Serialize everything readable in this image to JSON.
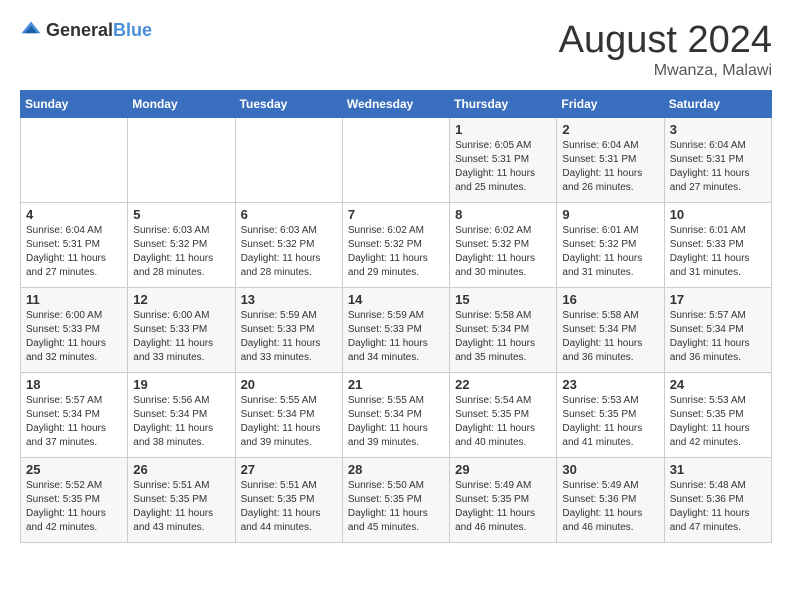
{
  "logo": {
    "general": "General",
    "blue": "Blue"
  },
  "title": "August 2024",
  "location": "Mwanza, Malawi",
  "days_of_week": [
    "Sunday",
    "Monday",
    "Tuesday",
    "Wednesday",
    "Thursday",
    "Friday",
    "Saturday"
  ],
  "weeks": [
    [
      {
        "day": "",
        "sunrise": "",
        "sunset": "",
        "daylight": ""
      },
      {
        "day": "",
        "sunrise": "",
        "sunset": "",
        "daylight": ""
      },
      {
        "day": "",
        "sunrise": "",
        "sunset": "",
        "daylight": ""
      },
      {
        "day": "",
        "sunrise": "",
        "sunset": "",
        "daylight": ""
      },
      {
        "day": "1",
        "sunrise": "Sunrise: 6:05 AM",
        "sunset": "Sunset: 5:31 PM",
        "daylight": "Daylight: 11 hours and 25 minutes."
      },
      {
        "day": "2",
        "sunrise": "Sunrise: 6:04 AM",
        "sunset": "Sunset: 5:31 PM",
        "daylight": "Daylight: 11 hours and 26 minutes."
      },
      {
        "day": "3",
        "sunrise": "Sunrise: 6:04 AM",
        "sunset": "Sunset: 5:31 PM",
        "daylight": "Daylight: 11 hours and 27 minutes."
      }
    ],
    [
      {
        "day": "4",
        "sunrise": "Sunrise: 6:04 AM",
        "sunset": "Sunset: 5:31 PM",
        "daylight": "Daylight: 11 hours and 27 minutes."
      },
      {
        "day": "5",
        "sunrise": "Sunrise: 6:03 AM",
        "sunset": "Sunset: 5:32 PM",
        "daylight": "Daylight: 11 hours and 28 minutes."
      },
      {
        "day": "6",
        "sunrise": "Sunrise: 6:03 AM",
        "sunset": "Sunset: 5:32 PM",
        "daylight": "Daylight: 11 hours and 28 minutes."
      },
      {
        "day": "7",
        "sunrise": "Sunrise: 6:02 AM",
        "sunset": "Sunset: 5:32 PM",
        "daylight": "Daylight: 11 hours and 29 minutes."
      },
      {
        "day": "8",
        "sunrise": "Sunrise: 6:02 AM",
        "sunset": "Sunset: 5:32 PM",
        "daylight": "Daylight: 11 hours and 30 minutes."
      },
      {
        "day": "9",
        "sunrise": "Sunrise: 6:01 AM",
        "sunset": "Sunset: 5:32 PM",
        "daylight": "Daylight: 11 hours and 31 minutes."
      },
      {
        "day": "10",
        "sunrise": "Sunrise: 6:01 AM",
        "sunset": "Sunset: 5:33 PM",
        "daylight": "Daylight: 11 hours and 31 minutes."
      }
    ],
    [
      {
        "day": "11",
        "sunrise": "Sunrise: 6:00 AM",
        "sunset": "Sunset: 5:33 PM",
        "daylight": "Daylight: 11 hours and 32 minutes."
      },
      {
        "day": "12",
        "sunrise": "Sunrise: 6:00 AM",
        "sunset": "Sunset: 5:33 PM",
        "daylight": "Daylight: 11 hours and 33 minutes."
      },
      {
        "day": "13",
        "sunrise": "Sunrise: 5:59 AM",
        "sunset": "Sunset: 5:33 PM",
        "daylight": "Daylight: 11 hours and 33 minutes."
      },
      {
        "day": "14",
        "sunrise": "Sunrise: 5:59 AM",
        "sunset": "Sunset: 5:33 PM",
        "daylight": "Daylight: 11 hours and 34 minutes."
      },
      {
        "day": "15",
        "sunrise": "Sunrise: 5:58 AM",
        "sunset": "Sunset: 5:34 PM",
        "daylight": "Daylight: 11 hours and 35 minutes."
      },
      {
        "day": "16",
        "sunrise": "Sunrise: 5:58 AM",
        "sunset": "Sunset: 5:34 PM",
        "daylight": "Daylight: 11 hours and 36 minutes."
      },
      {
        "day": "17",
        "sunrise": "Sunrise: 5:57 AM",
        "sunset": "Sunset: 5:34 PM",
        "daylight": "Daylight: 11 hours and 36 minutes."
      }
    ],
    [
      {
        "day": "18",
        "sunrise": "Sunrise: 5:57 AM",
        "sunset": "Sunset: 5:34 PM",
        "daylight": "Daylight: 11 hours and 37 minutes."
      },
      {
        "day": "19",
        "sunrise": "Sunrise: 5:56 AM",
        "sunset": "Sunset: 5:34 PM",
        "daylight": "Daylight: 11 hours and 38 minutes."
      },
      {
        "day": "20",
        "sunrise": "Sunrise: 5:55 AM",
        "sunset": "Sunset: 5:34 PM",
        "daylight": "Daylight: 11 hours and 39 minutes."
      },
      {
        "day": "21",
        "sunrise": "Sunrise: 5:55 AM",
        "sunset": "Sunset: 5:34 PM",
        "daylight": "Daylight: 11 hours and 39 minutes."
      },
      {
        "day": "22",
        "sunrise": "Sunrise: 5:54 AM",
        "sunset": "Sunset: 5:35 PM",
        "daylight": "Daylight: 11 hours and 40 minutes."
      },
      {
        "day": "23",
        "sunrise": "Sunrise: 5:53 AM",
        "sunset": "Sunset: 5:35 PM",
        "daylight": "Daylight: 11 hours and 41 minutes."
      },
      {
        "day": "24",
        "sunrise": "Sunrise: 5:53 AM",
        "sunset": "Sunset: 5:35 PM",
        "daylight": "Daylight: 11 hours and 42 minutes."
      }
    ],
    [
      {
        "day": "25",
        "sunrise": "Sunrise: 5:52 AM",
        "sunset": "Sunset: 5:35 PM",
        "daylight": "Daylight: 11 hours and 42 minutes."
      },
      {
        "day": "26",
        "sunrise": "Sunrise: 5:51 AM",
        "sunset": "Sunset: 5:35 PM",
        "daylight": "Daylight: 11 hours and 43 minutes."
      },
      {
        "day": "27",
        "sunrise": "Sunrise: 5:51 AM",
        "sunset": "Sunset: 5:35 PM",
        "daylight": "Daylight: 11 hours and 44 minutes."
      },
      {
        "day": "28",
        "sunrise": "Sunrise: 5:50 AM",
        "sunset": "Sunset: 5:35 PM",
        "daylight": "Daylight: 11 hours and 45 minutes."
      },
      {
        "day": "29",
        "sunrise": "Sunrise: 5:49 AM",
        "sunset": "Sunset: 5:35 PM",
        "daylight": "Daylight: 11 hours and 46 minutes."
      },
      {
        "day": "30",
        "sunrise": "Sunrise: 5:49 AM",
        "sunset": "Sunset: 5:36 PM",
        "daylight": "Daylight: 11 hours and 46 minutes."
      },
      {
        "day": "31",
        "sunrise": "Sunrise: 5:48 AM",
        "sunset": "Sunset: 5:36 PM",
        "daylight": "Daylight: 11 hours and 47 minutes."
      }
    ]
  ]
}
